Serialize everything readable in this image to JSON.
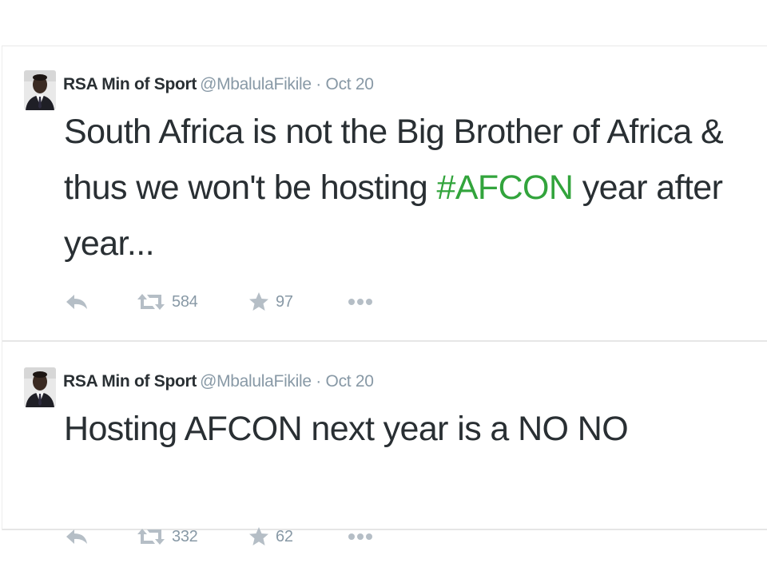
{
  "tweets": [
    {
      "author_name": "RSA Min of Sport",
      "handle": "@MbalulaFikile",
      "separator": "·",
      "date": "Oct 20",
      "text_before": "South Africa is not the Big Brother of Africa & thus we won't be hosting ",
      "hashtag": "#AFCON",
      "text_after": " year after year...",
      "retweets": "584",
      "favorites": "97"
    },
    {
      "author_name": "RSA Min of Sport",
      "handle": "@MbalulaFikile",
      "separator": "·",
      "date": "Oct 20",
      "text": "Hosting AFCON next year is a NO NO",
      "retweets": "332",
      "favorites": "62"
    }
  ],
  "icons": {
    "reply": "reply-icon",
    "retweet": "retweet-icon",
    "favorite": "star-icon",
    "more": "more-dots-icon"
  },
  "colors": {
    "hashtag": "#32a43c",
    "text": "#292f33",
    "meta": "#8899a6",
    "action_icon": "#b5bec6"
  }
}
